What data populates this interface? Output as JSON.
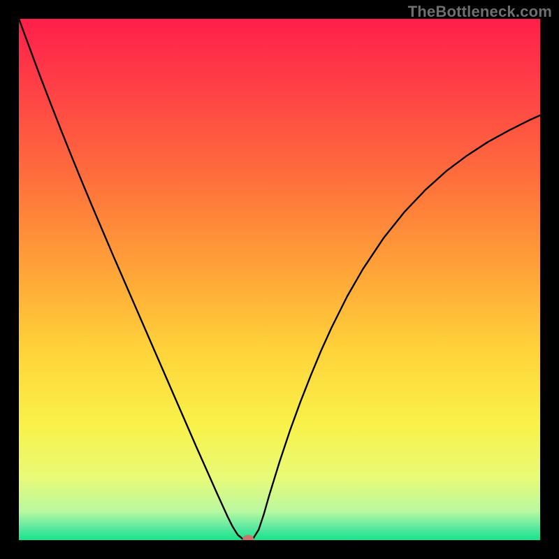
{
  "watermark": "TheBottleneck.com",
  "chart_data": {
    "type": "line",
    "title": "",
    "xlabel": "",
    "ylabel": "",
    "xlim": [
      0,
      100
    ],
    "ylim": [
      0,
      100
    ],
    "gradient_stops": [
      {
        "offset": 0.0,
        "color": "#ff1f4b"
      },
      {
        "offset": 0.12,
        "color": "#ff3d47"
      },
      {
        "offset": 0.3,
        "color": "#ff6d3c"
      },
      {
        "offset": 0.48,
        "color": "#ffa338"
      },
      {
        "offset": 0.64,
        "color": "#ffd43a"
      },
      {
        "offset": 0.78,
        "color": "#f8f24a"
      },
      {
        "offset": 0.88,
        "color": "#e8fa77"
      },
      {
        "offset": 0.945,
        "color": "#b9f8a0"
      },
      {
        "offset": 0.975,
        "color": "#5ee9a1"
      },
      {
        "offset": 1.0,
        "color": "#17e38a"
      }
    ],
    "series": [
      {
        "name": "bottleneck-curve",
        "x": [
          0.0,
          2.0,
          4.0,
          6.0,
          8.0,
          10.0,
          12.0,
          14.0,
          16.0,
          18.0,
          20.0,
          22.0,
          24.0,
          26.0,
          28.0,
          30.0,
          32.0,
          34.0,
          36.0,
          38.0,
          40.0,
          41.0,
          42.0,
          43.0,
          44.0,
          45.0,
          46.0,
          47.0,
          48.0,
          50.0,
          52.0,
          54.0,
          56.0,
          58.0,
          60.0,
          63.0,
          66.0,
          70.0,
          74.0,
          78.0,
          82.0,
          86.0,
          90.0,
          94.0,
          98.0,
          100.0
        ],
        "values": [
          100.0,
          94.6,
          89.2,
          84.0,
          78.9,
          73.9,
          69.0,
          64.2,
          59.5,
          54.8,
          50.2,
          45.6,
          41.0,
          36.4,
          31.8,
          27.2,
          22.6,
          18.0,
          13.5,
          9.0,
          4.6,
          2.6,
          1.0,
          0.2,
          0.0,
          0.4,
          2.0,
          5.0,
          8.5,
          15.0,
          21.0,
          26.5,
          31.6,
          36.4,
          40.8,
          46.8,
          52.0,
          58.0,
          63.0,
          67.2,
          70.8,
          73.8,
          76.4,
          78.6,
          80.6,
          81.5
        ]
      }
    ],
    "marker": {
      "x": 44.0,
      "y": 0.2,
      "color": "#c9756b"
    }
  }
}
